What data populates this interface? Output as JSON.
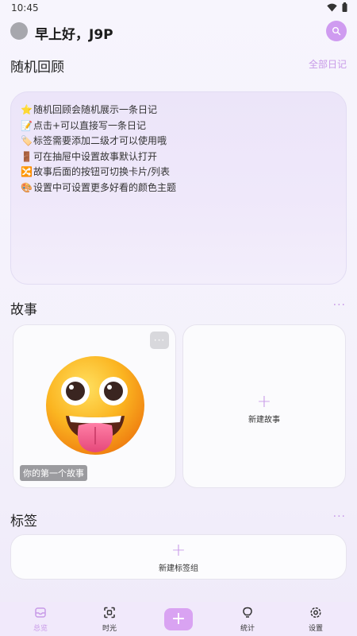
{
  "status": {
    "time": "10:45"
  },
  "header": {
    "greeting": "早上好，J9P"
  },
  "review": {
    "title": "随机回顾",
    "link": "全部日记",
    "tips": [
      {
        "emoji": "⭐",
        "text": "随机回顾会随机展示一条日记"
      },
      {
        "emoji": "📝",
        "text": "点击+可以直接写一条日记"
      },
      {
        "emoji": "🏷️",
        "text": "标签需要添加二级才可以使用哦"
      },
      {
        "emoji": "🚪",
        "text": "可在抽屉中设置故事默认打开"
      },
      {
        "emoji": "🔀",
        "text": "故事后面的按钮可切换卡片/列表"
      },
      {
        "emoji": "🎨",
        "text": "设置中可设置更多好看的颜色主题"
      }
    ]
  },
  "stories": {
    "title": "故事",
    "more": "···",
    "first_story": {
      "label": "你的第一个故事",
      "more": "···"
    },
    "new_story": {
      "icon": "+",
      "label": "新建故事"
    }
  },
  "tags": {
    "title": "标签",
    "more": "···",
    "new_group": {
      "icon": "+",
      "label": "新建标签组"
    }
  },
  "nav": {
    "items": [
      {
        "icon": "inbox-icon",
        "label": "总览"
      },
      {
        "icon": "scan-icon",
        "label": "时光"
      },
      {
        "icon": "lightbulb-icon",
        "label": "统计"
      },
      {
        "icon": "gear-icon",
        "label": "设置"
      }
    ],
    "add": "+"
  },
  "colors": {
    "accent": "#cf9bf0",
    "nav_active": "#c89ae8",
    "background": "#f4f1fb"
  }
}
